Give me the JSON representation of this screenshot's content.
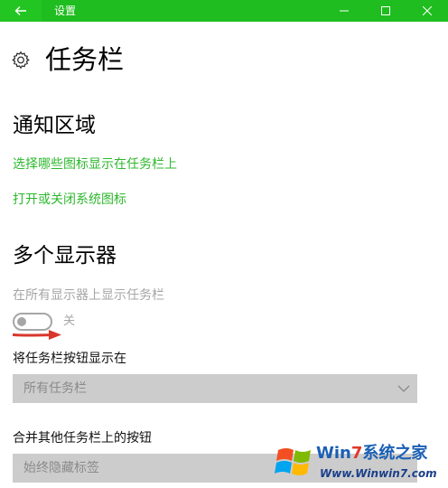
{
  "window": {
    "title": "设置",
    "accent": "#1fbd1f"
  },
  "page": {
    "title": "任务栏",
    "icon": "gear-icon"
  },
  "notification_area": {
    "heading": "通知区域",
    "links": [
      "选择哪些图标显示在任务栏上",
      "打开或关闭系统图标"
    ],
    "link_color": "#2db82d"
  },
  "multiple_displays": {
    "heading": "多个显示器",
    "show_on_all_label": "在所有显示器上显示任务栏",
    "toggle_state": "关",
    "toggle_on": false,
    "buttons_position_label": "将任务栏按钮显示在",
    "buttons_position_value": "所有任务栏",
    "combine_label": "合并其他任务栏上的按钮",
    "combine_value": "始终隐藏标签"
  },
  "watermark": {
    "brand_prefix": "Win",
    "brand_seven": "7",
    "brand_suffix": "系统之家",
    "url": "Www.Winwin7.com"
  }
}
